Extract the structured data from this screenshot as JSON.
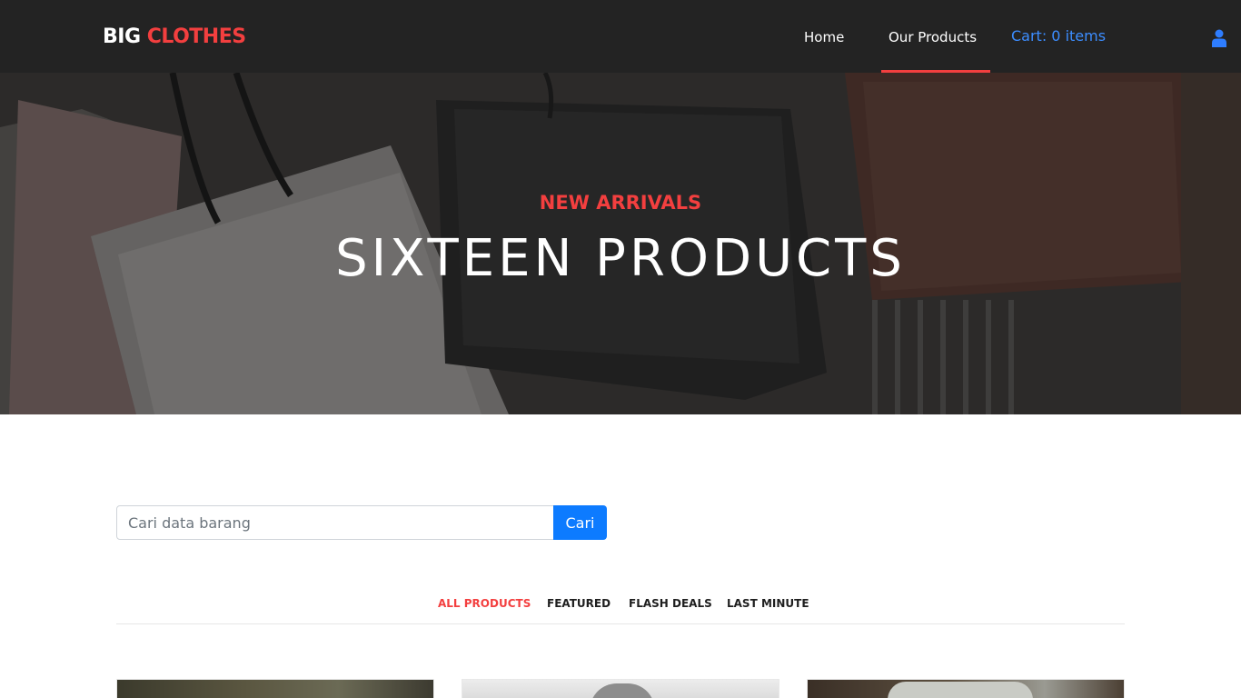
{
  "navbar": {
    "brand": {
      "part1": "BIG",
      "part2": "CLOTHES"
    },
    "links": [
      {
        "label": "Home"
      },
      {
        "label": "Our Products",
        "active": true
      },
      {
        "label": "Cart: 0 items"
      }
    ],
    "user_icon": "user-icon"
  },
  "hero": {
    "kicker": "NEW ARRIVALS",
    "title": "SIXTEEN PRODUCTS"
  },
  "search": {
    "placeholder": "Cari data barang",
    "value": "",
    "button_label": "Cari"
  },
  "filters": {
    "tabs": [
      {
        "label": "ALL PRODUCTS",
        "active": true
      },
      {
        "label": "FEATURED"
      },
      {
        "label": "FLASH DEALS"
      },
      {
        "label": "LAST MINUTE"
      }
    ]
  },
  "colors": {
    "accent": "#f33f3f",
    "navbar_bg": "#232323",
    "link_blue": "#3c8dff",
    "button_blue": "#0d7bff"
  }
}
